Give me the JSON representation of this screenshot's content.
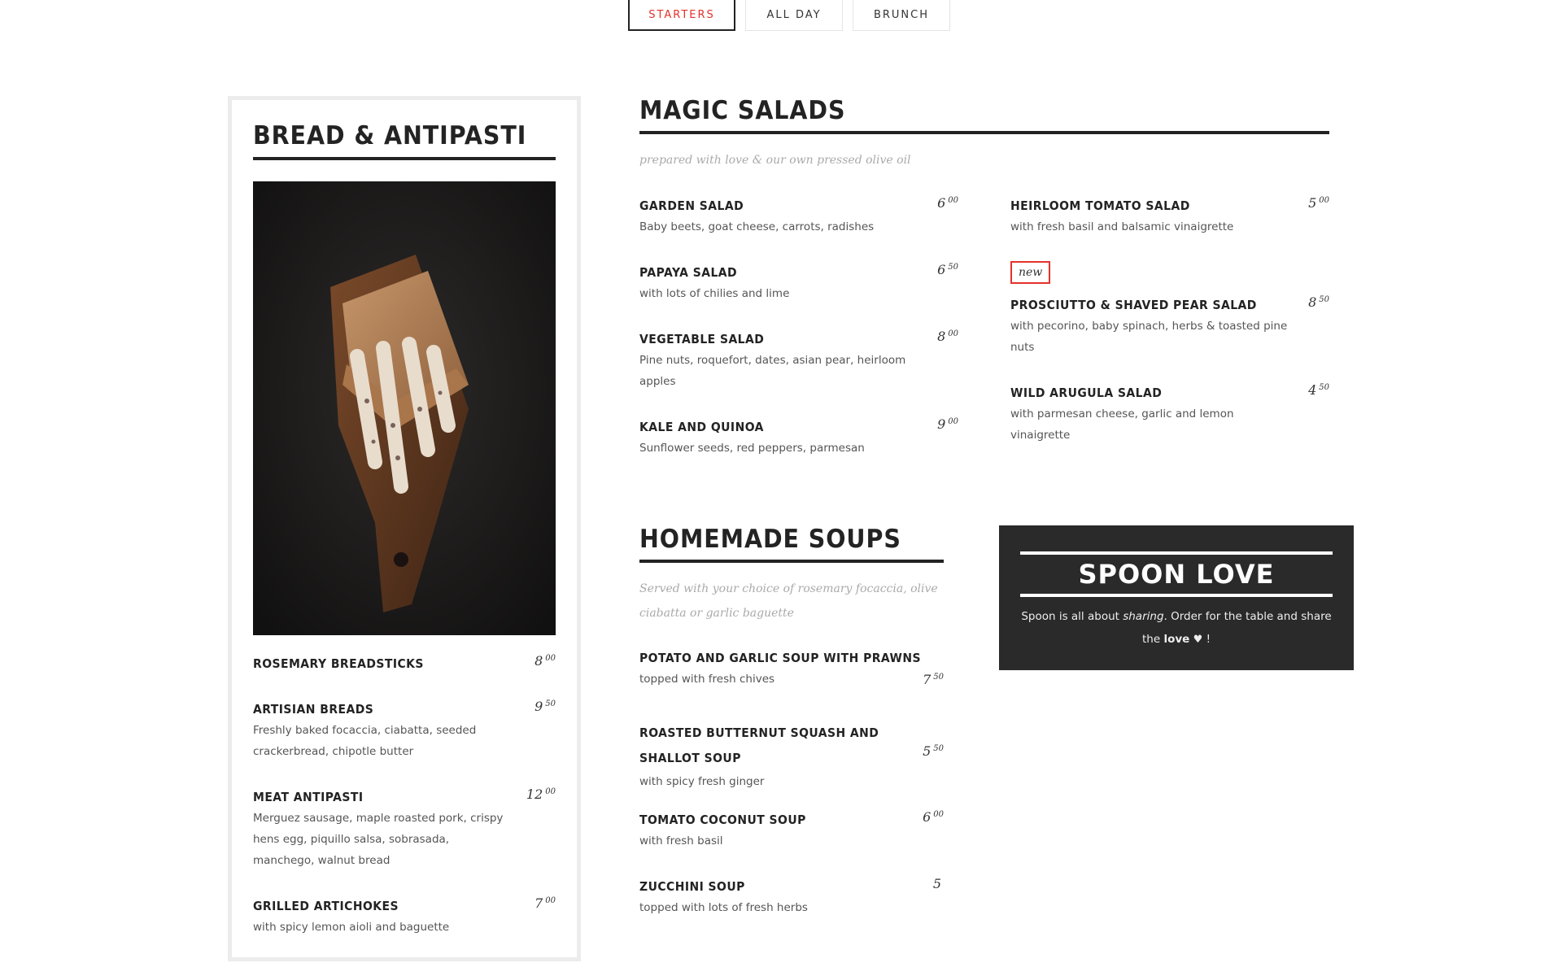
{
  "tabs": [
    {
      "label": "STARTERS",
      "active": true
    },
    {
      "label": "ALL DAY",
      "active": false
    },
    {
      "label": "BRUNCH",
      "active": false
    }
  ],
  "colors": {
    "accent": "#e4322b",
    "dark": "#2a2a2a",
    "text": "#232323"
  },
  "bread": {
    "title": "BREAD & ANTIPASTI",
    "items": [
      {
        "name": "ROSEMARY BREADSTICKS",
        "price_main": "8",
        "price_cents": "00",
        "desc": ""
      },
      {
        "name": "ARTISIAN BREADS",
        "price_main": "9",
        "price_cents": "50",
        "desc": "Freshly baked focaccia, ciabatta, seeded crackerbread, chipotle butter"
      },
      {
        "name": "MEAT ANTIPASTI",
        "price_main": "12",
        "price_cents": "00",
        "desc": "Merguez sausage, maple roasted pork, crispy hens egg, piquillo salsa, sobrasada, manchego, walnut bread"
      },
      {
        "name": "GRILLED ARTICHOKES",
        "price_main": "7",
        "price_cents": "00",
        "desc": "with spicy lemon aioli and baguette"
      }
    ]
  },
  "salads": {
    "title": "MAGIC SALADS",
    "subtitle": "prepared with love & our own pressed olive oil",
    "left": [
      {
        "name": "GARDEN SALAD",
        "price_main": "6",
        "price_cents": "00",
        "desc": "Baby beets, goat cheese, carrots, radishes"
      },
      {
        "name": "PAPAYA SALAD",
        "price_main": "6",
        "price_cents": "50",
        "desc": "with lots of chilies and lime"
      },
      {
        "name": "VEGETABLE SALAD",
        "price_main": "8",
        "price_cents": "00",
        "desc": "Pine nuts, roquefort, dates, asian pear, heirloom apples"
      },
      {
        "name": "KALE AND QUINOA",
        "price_main": "9",
        "price_cents": "00",
        "desc": "Sunflower seeds, red peppers, parmesan"
      }
    ],
    "right": [
      {
        "name": "HEIRLOOM TOMATO SALAD",
        "price_main": "5",
        "price_cents": "00",
        "desc": "with fresh basil and balsamic vinaigrette"
      },
      {
        "name": "PROSCIUTTO & SHAVED PEAR SALAD",
        "price_main": "8",
        "price_cents": "50",
        "desc": "with pecorino, baby spinach, herbs & toasted pine nuts",
        "badge": "new"
      },
      {
        "name": "WILD ARUGULA SALAD",
        "price_main": "4",
        "price_cents": "50",
        "desc": "with parmesan cheese, garlic and lemon vinaigrette"
      }
    ]
  },
  "soups": {
    "title": "HOMEMADE SOUPS",
    "subtitle": "Served with your choice of rosemary focaccia, olive ciabatta or garlic baguette",
    "items": [
      {
        "name": "POTATO AND GARLIC SOUP WITH PRAWNS",
        "price_main": "7",
        "price_cents": "50",
        "desc": "topped with fresh chives"
      },
      {
        "name": "ROASTED BUTTERNUT SQUASH AND SHALLOT SOUP",
        "price_main": "5",
        "price_cents": "50",
        "desc": "with spicy fresh ginger"
      },
      {
        "name": "TOMATO COCONUT SOUP",
        "price_main": "6",
        "price_cents": "00",
        "desc": "with fresh basil"
      },
      {
        "name": "ZUCCHINI SOUP",
        "price_main": "5",
        "price_cents": "",
        "desc": "topped with lots of fresh herbs"
      }
    ]
  },
  "spoon": {
    "title": "SPOON LOVE",
    "text_before": "Spoon is all about ",
    "text_em": "sharing",
    "text_mid": ". Order for the table and share the ",
    "text_bold": "love",
    "text_end": " !"
  }
}
